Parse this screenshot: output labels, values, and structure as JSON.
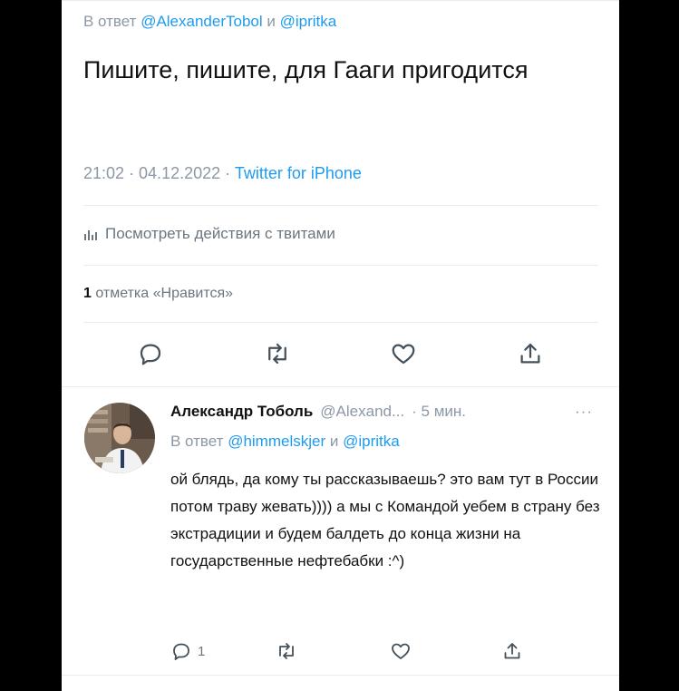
{
  "tweet": {
    "reply_prefix": "В ответ",
    "reply_mention_1": "@AlexanderTobol",
    "reply_conj": "и",
    "reply_mention_2": "@ipritka",
    "text": "Пишите, пишите, для Гааги пригодится",
    "timestamp": "21:02 · 04.12.2022 ·",
    "source": "Twitter for iPhone",
    "activity_label": "Посмотреть действия с твитами",
    "likes_count": "1",
    "likes_label": "отметка «Нравится»"
  },
  "reply": {
    "author_name": "Александр Тоболь",
    "author_handle": "@Alexand...",
    "time_ago": "· 5 мин.",
    "more": "···",
    "reply_prefix": "В ответ",
    "reply_mention_1": "@himmelskjer",
    "reply_conj": "и",
    "reply_mention_2": "@ipritka",
    "text": "ой блядь, да кому ты рассказываешь? это вам тут в России потом траву жевать)))) а мы с Командой уебем в страну без экстрадиции и будем балдеть до конца жизни на государственные нефтебабки :^)",
    "reply_count": "1"
  },
  "colors": {
    "accent": "#1d9bf0",
    "muted": "#8b98a5",
    "text": "#111111",
    "divider": "#e6ecf0"
  },
  "icons": {
    "reply": "reply-icon",
    "retweet": "retweet-icon",
    "like": "like-icon",
    "share": "share-icon",
    "analytics": "analytics-icon"
  }
}
